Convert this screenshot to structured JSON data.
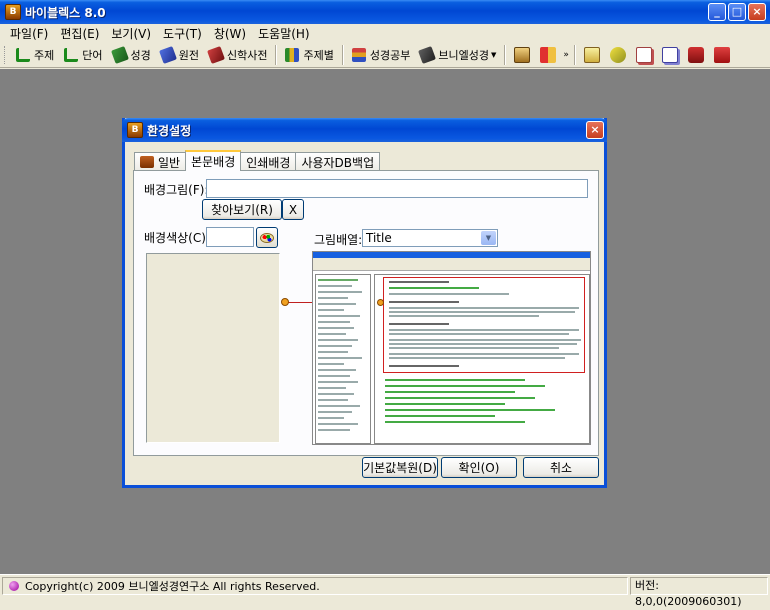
{
  "app": {
    "title": "바이블렉스 8.0",
    "icon": "bible-app-icon"
  },
  "menu": [
    "파일(F)",
    "편집(E)",
    "보기(V)",
    "도구(T)",
    "창(W)",
    "도움말(H)"
  ],
  "toolbar": {
    "buttons": [
      {
        "label": "주제",
        "color": "#1B8A1B"
      },
      {
        "label": "단어",
        "color": "#1B8A1B"
      },
      {
        "label": "성경",
        "color": "#2A7A2A"
      },
      {
        "label": "원전",
        "color": "#3050C0"
      },
      {
        "label": "신학사전",
        "color": "#A02020"
      },
      {
        "label": "주제별",
        "color": "#2A8A2A"
      },
      {
        "label": "성경공부",
        "color": "#B03030"
      },
      {
        "label": "브니엘성경",
        "color": "#404040"
      }
    ],
    "overflow": "»"
  },
  "window_controls": {
    "minimize": "_",
    "maximize": "□",
    "close": "×"
  },
  "dialog": {
    "title": "환경설정",
    "close": "×",
    "tabs": [
      "일반",
      "본문배경",
      "인쇄배경",
      "사용자DB백업"
    ],
    "active_tab": "본문배경",
    "bg_image_label": "배경그림(F):",
    "bg_image_value": "",
    "browse_button": "찾아보기(R)",
    "clear_button": "X",
    "bg_color_label": "배경색상(C):",
    "layout_label": "그림배열:",
    "layout_value": "Title",
    "reset_button": "기본값복원(D)",
    "ok_button": "확인(O)",
    "cancel_button": "취소"
  },
  "status": {
    "copyright": "Copyright(c) 2009 브니엘성경연구소 All rights Reserved.",
    "version": "버전: 8,0,0(2009060301)"
  }
}
